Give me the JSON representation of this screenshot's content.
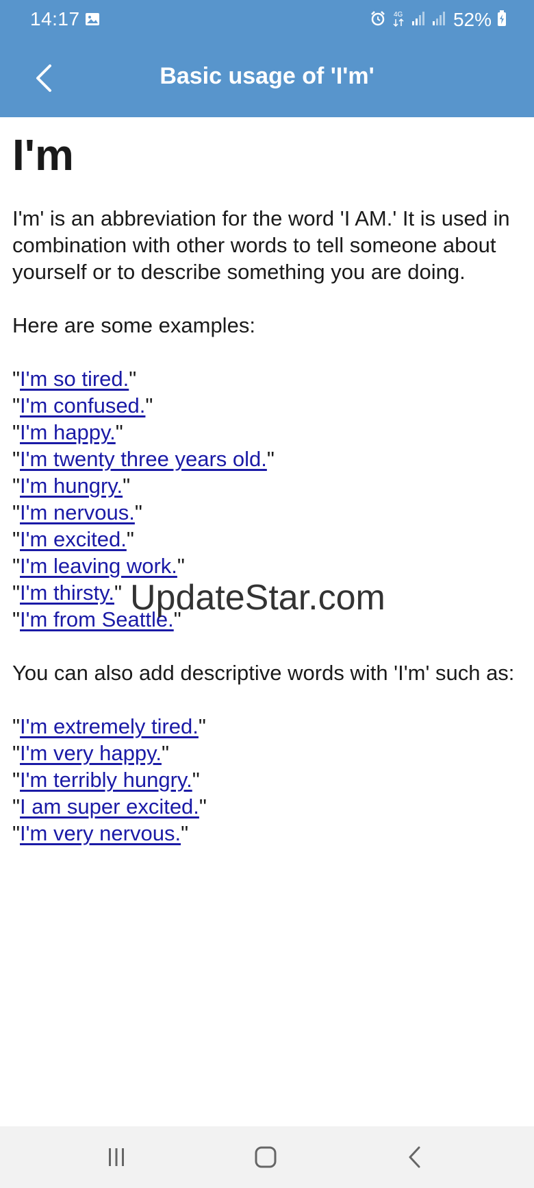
{
  "status_bar": {
    "time": "14:17",
    "battery_text": "52%",
    "network_label": "4G",
    "icons": [
      "gallery-icon",
      "alarm-icon",
      "network-4g-icon",
      "signal-icon",
      "signal-icon",
      "battery-icon"
    ]
  },
  "app_bar": {
    "title": "Basic usage of 'I'm'",
    "back_icon": "chevron-left-icon"
  },
  "page": {
    "title": "I'm",
    "intro": "I'm' is an abbreviation for the word 'I AM.' It is used in combination with other words to tell someone about yourself or to describe something you are doing.",
    "examples_intro": "Here are some examples:",
    "examples": [
      "I'm so tired.",
      "I'm confused.",
      "I'm happy.",
      "I'm twenty three years old.",
      "I'm hungry.",
      "I'm nervous.",
      "I'm excited.",
      "I'm leaving work.",
      "I'm thirsty.",
      "I'm from Seattle."
    ],
    "descriptive_intro": "You can also add descriptive words with 'I'm' such as:",
    "descriptive_examples": [
      "I'm extremely tired.",
      "I'm very happy.",
      "I'm terribly hungry.",
      "I am super excited.",
      "I'm very nervous."
    ]
  },
  "watermark": "UpdateStar.com",
  "nav_bar": {
    "buttons": [
      "recent-apps-icon",
      "home-icon",
      "back-icon"
    ]
  },
  "colors": {
    "header": "#5895cc",
    "link": "#1a1aa6",
    "text": "#1a1a1a",
    "nav_background": "#f2f2f2"
  }
}
